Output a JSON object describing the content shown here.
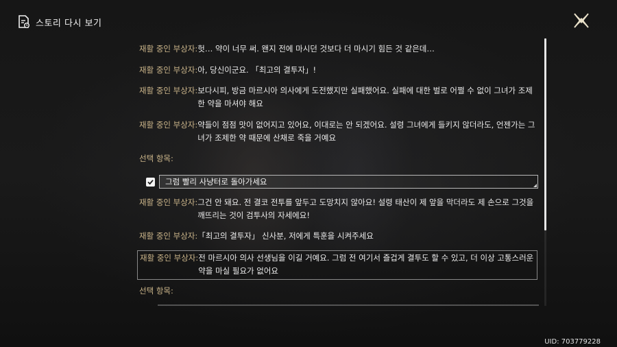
{
  "header": {
    "title": "스토리 다시 보기"
  },
  "dialogue": [
    {
      "speaker": "재활 중인 부상자:",
      "text": "헛… 약이 너무 써. 왠지 전에 마시던 것보다 더 마시기 힘든 것 같은데…"
    },
    {
      "speaker": "재활 중인 부상자:",
      "text": "아, 당신이군요. 「최고의 결투자」!"
    },
    {
      "speaker": "재활 중인 부상자:",
      "text": "보다시피, 방금 마르시아 의사에게 도전했지만 실패했어요. 실패에 대한 벌로 어쩔 수 없이 그녀가 조제한 약을 마셔야 해요"
    },
    {
      "speaker": "재활 중인 부상자:",
      "text": "약들이 점점 맛이 없어지고 있어요, 이대로는 안 되겠어요. 설령 그녀에게 들키지 않더라도, 언젠가는 그녀가 조제한 약 때문에 산채로 죽을 거예요"
    },
    {
      "speaker": "재활 중인 부상자:",
      "text": "그건 안 돼요. 전 결코 전투를 앞두고 도망치지 않아요! 설령 태산이 제 앞을 막더라도 제 손으로 그것을 깨뜨리는 것이 검투사의 자세에요!"
    },
    {
      "speaker": "재활 중인 부상자:",
      "text": "「최고의 결투자」 신사분, 저에게 특훈을 시켜주세요"
    },
    {
      "speaker": "재활 중인 부상자:",
      "text": "전 마르시아 의사 선생님을 이길 거예요. 그럼 전 여기서 즐겁게 결투도 할 수 있고, 더 이상 고통스러운 약을 마실 필요가 없어요"
    }
  ],
  "choices": {
    "label": "선택 항목:",
    "label2": "선택 항목:",
    "selected": "그럼 빨리 사냥터로 돌아가세요"
  },
  "uid": "UID: 703779228"
}
